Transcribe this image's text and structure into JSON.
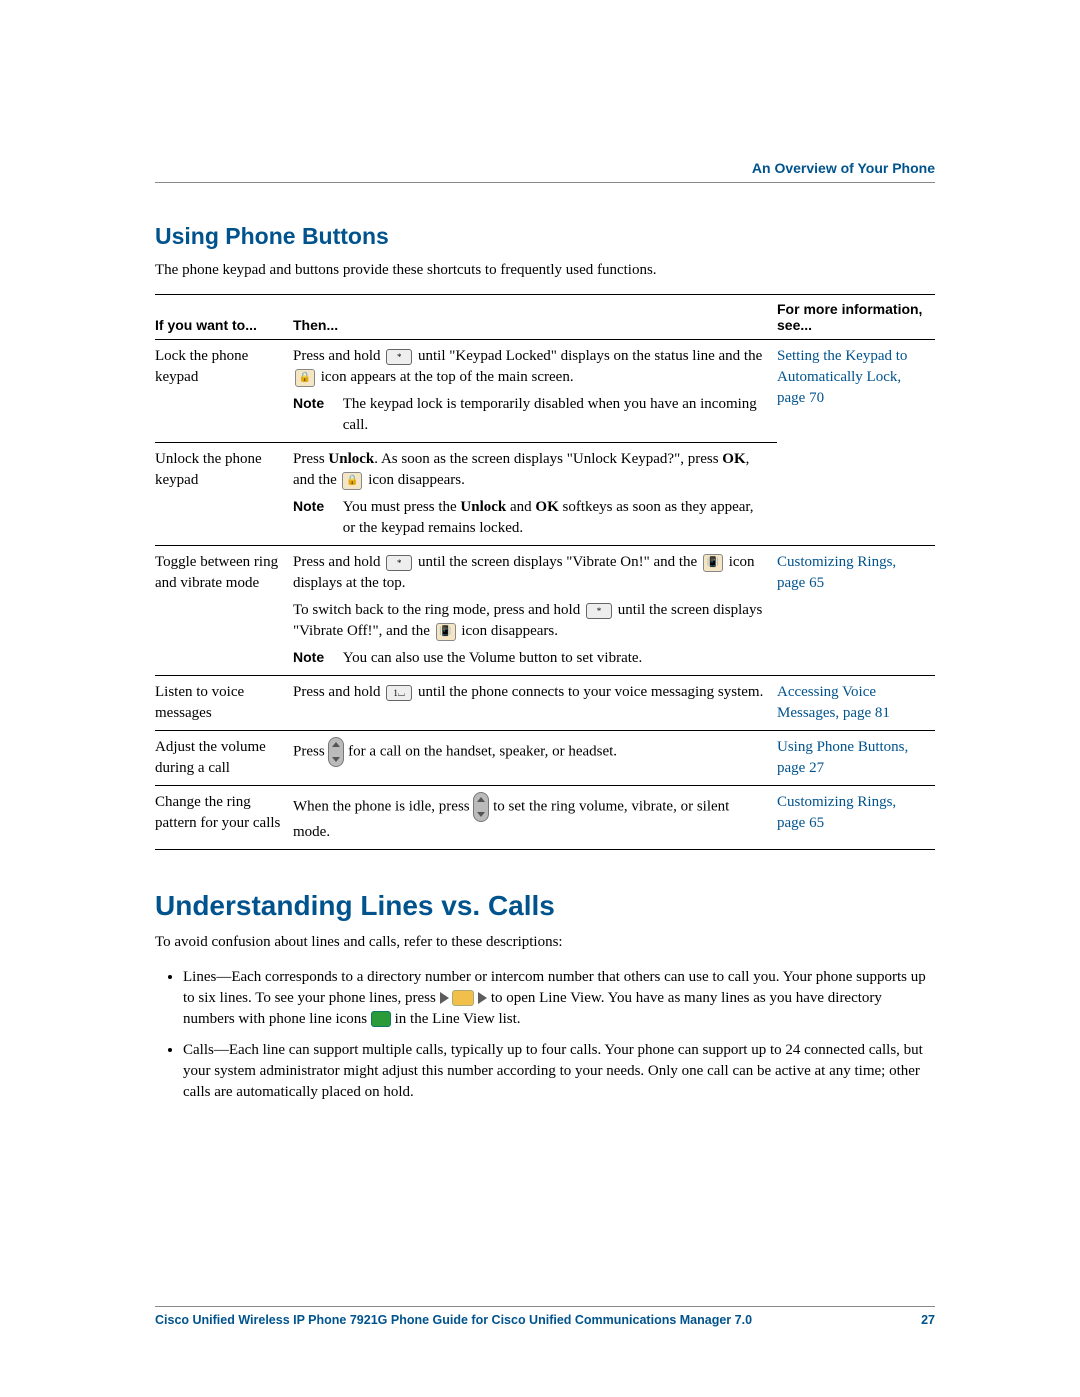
{
  "chapter_header": "An Overview of Your Phone",
  "section1": {
    "title": "Using Phone Buttons",
    "intro": "The phone keypad and buttons provide these shortcuts to frequently used functions."
  },
  "table": {
    "headers": {
      "c1": "If you want to...",
      "c2": "Then...",
      "c3": "For more information, see..."
    },
    "rows": [
      {
        "want": "Lock the phone keypad",
        "then_a": "Press and hold ",
        "then_b": " until \"Keypad Locked\" displays on the status line and the ",
        "then_c": " icon appears at the top of the main screen.",
        "note_label": "Note",
        "note": "The keypad lock is temporarily disabled when you have an incoming call.",
        "link": "Setting the Keypad to Automatically Lock, page 70"
      },
      {
        "want": "Unlock the phone keypad",
        "then_a": "Press ",
        "unlock": "Unlock",
        "then_b": ". As soon as the screen displays \"Unlock Keypad?\", press ",
        "ok": "OK",
        "then_c": ", and the ",
        "then_d": " icon disappears.",
        "note_label": "Note",
        "note_a": "You must press the ",
        "note_b": " and ",
        "note_c": " softkeys as soon as they appear, or the keypad remains locked.",
        "link": ""
      },
      {
        "want": "Toggle between ring and vibrate mode",
        "then_a": "Press and hold ",
        "then_b": " until the screen displays \"Vibrate On!\" and the ",
        "then_c": " icon displays at the top.",
        "then_d": "To switch back to the ring mode, press and hold ",
        "then_e": " until the screen displays \"Vibrate Off!\", and the ",
        "then_f": " icon disappears.",
        "note_label": "Note",
        "note": "You can also use the Volume button to set vibrate.",
        "link": "Customizing Rings, page 65"
      },
      {
        "want": "Listen to voice messages",
        "then_a": "Press and hold ",
        "then_b": " until the phone connects to your voice messaging system.",
        "link": "Accessing Voice Messages, page 81"
      },
      {
        "want": "Adjust the volume during a call",
        "then_a": "Press ",
        "then_b": " for a call on the handset, speaker, or headset.",
        "link": "Using Phone Buttons, page 27"
      },
      {
        "want": "Change the ring pattern for your calls",
        "then_a": "When the phone is idle, press ",
        "then_b": " to set the ring volume, vibrate, or silent mode.",
        "link": "Customizing Rings, page 65"
      }
    ]
  },
  "section2": {
    "title": "Understanding Lines vs. Calls",
    "intro": "To avoid confusion about lines and calls, refer to these descriptions:",
    "bullet1_a": "Lines—Each corresponds to a directory number or intercom number that others can use to call you. Your phone supports up to six lines. To see your phone lines, press ",
    "bullet1_b": " to open Line View. You have as many lines as you have directory numbers with phone line icons ",
    "bullet1_c": " in the Line View list.",
    "bullet2": "Calls—Each line can support multiple calls, typically up to four calls. Your phone can support up to 24 connected calls, but your system administrator might adjust this number according to your needs. Only one call can be active at any time; other calls are automatically placed on hold."
  },
  "footer": {
    "title": "Cisco Unified Wireless IP Phone 7921G Phone Guide for Cisco Unified Communications Manager 7.0",
    "page": "27"
  }
}
